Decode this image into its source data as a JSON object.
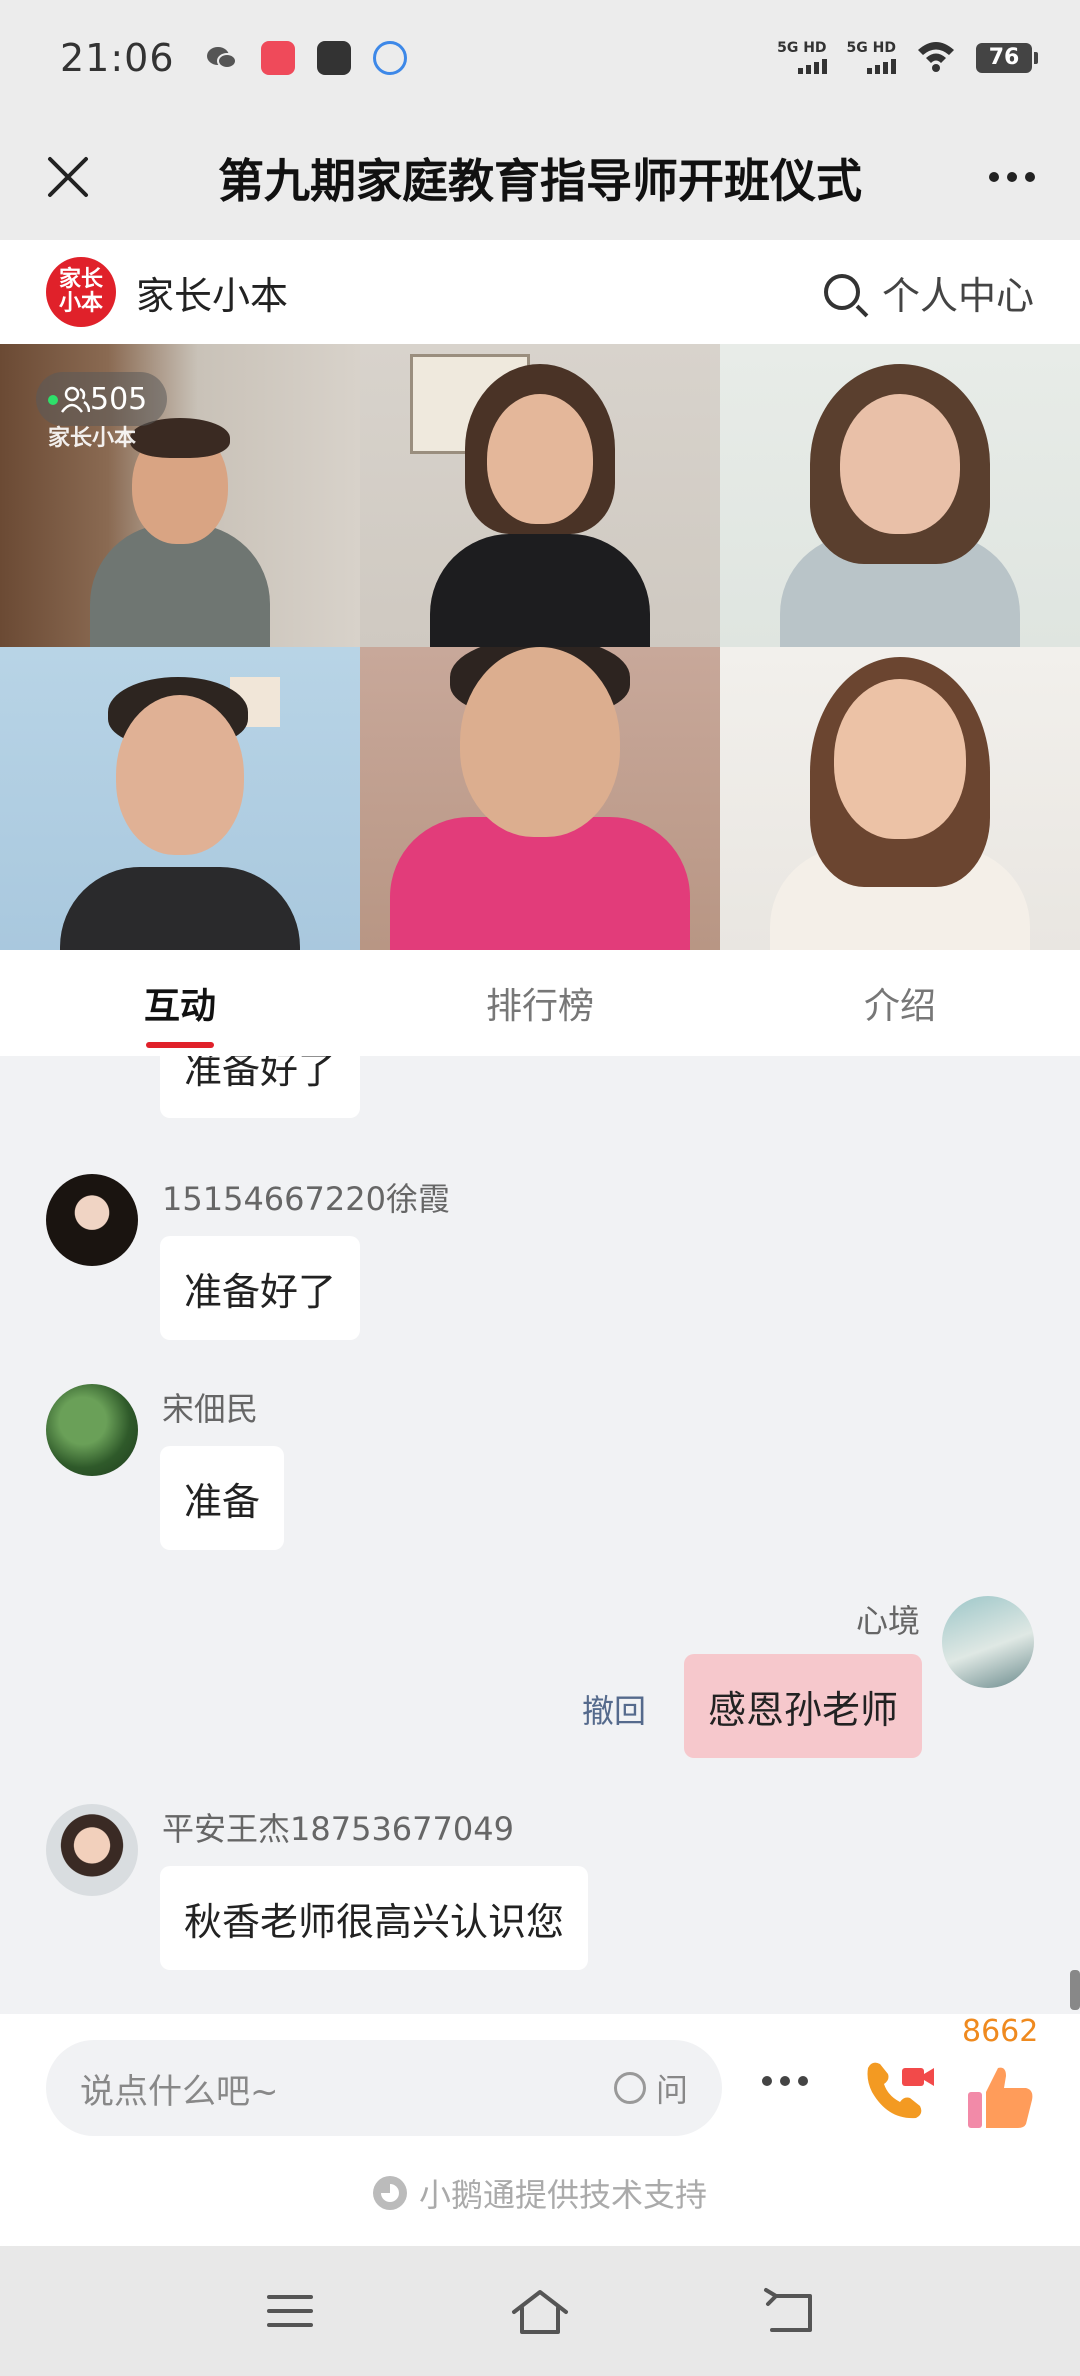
{
  "status_bar": {
    "time": "21:06",
    "network_1": "5G HD",
    "network_2": "5G HD",
    "battery": "76",
    "icons": [
      "wechat-icon",
      "app-red-icon",
      "app-dark-icon",
      "app-chat-icon",
      "signal-icon",
      "wifi-icon",
      "battery-icon"
    ]
  },
  "header": {
    "title": "第九期家庭教育指导师开班仪式",
    "close_icon": "close-icon",
    "more_icon": "more-icon"
  },
  "brand": {
    "logo_line1": "家长",
    "logo_line2": "小本",
    "name": "家长小本",
    "personal_center": "个人中心"
  },
  "video": {
    "viewer_count": "505",
    "watermark": "家长小本",
    "tiles": 6
  },
  "tabs": [
    {
      "label": "互动",
      "active": true
    },
    {
      "label": "排行榜",
      "active": false
    },
    {
      "label": "介绍",
      "active": false
    }
  ],
  "chat": {
    "messages": [
      {
        "nick": "",
        "text": "准备好了",
        "mine": false
      },
      {
        "nick": "15154667220徐霞",
        "text": "准备好了",
        "mine": false
      },
      {
        "nick": "宋佃民",
        "text": "准备",
        "mine": false
      },
      {
        "nick": "心境",
        "text": "感恩孙老师",
        "mine": true,
        "recall": "撤回"
      },
      {
        "nick": "平安王杰18753677049",
        "text": "秋香老师很高兴认识您",
        "mine": false
      }
    ]
  },
  "input": {
    "placeholder": "说点什么吧~",
    "ask_label": "问",
    "like_count": "8662",
    "support_text": "小鹅通提供技术支持"
  },
  "colors": {
    "accent": "#e0212a",
    "my_bubble": "#f6c8cc",
    "like_count": "#ef8a1f"
  }
}
